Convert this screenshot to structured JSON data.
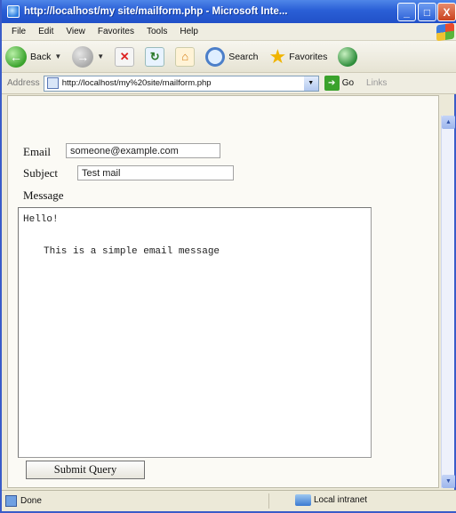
{
  "window": {
    "title": "http://localhost/my site/mailform.php - Microsoft Inte...",
    "min_glyph": "_",
    "max_glyph": "□",
    "close_glyph": "X"
  },
  "menu": [
    "File",
    "Edit",
    "View",
    "Favorites",
    "Tools",
    "Help"
  ],
  "toolbar": {
    "back_label": "Back",
    "search_label": "Search",
    "favorites_label": "Favorites"
  },
  "address": {
    "label": "Address",
    "url": "http://localhost/my%20site/mailform.php",
    "go_label": "Go",
    "links_label": "Links"
  },
  "form": {
    "email_label": "Email",
    "email_value": "someone@example.com",
    "subject_label": "Subject",
    "subject_value": "Test mail",
    "message_label": "Message",
    "message_line1": "Hello!",
    "message_line2": "This is a simple email message",
    "submit_label": "Submit Query"
  },
  "status": {
    "text": "Done",
    "zone": "Local intranet"
  }
}
